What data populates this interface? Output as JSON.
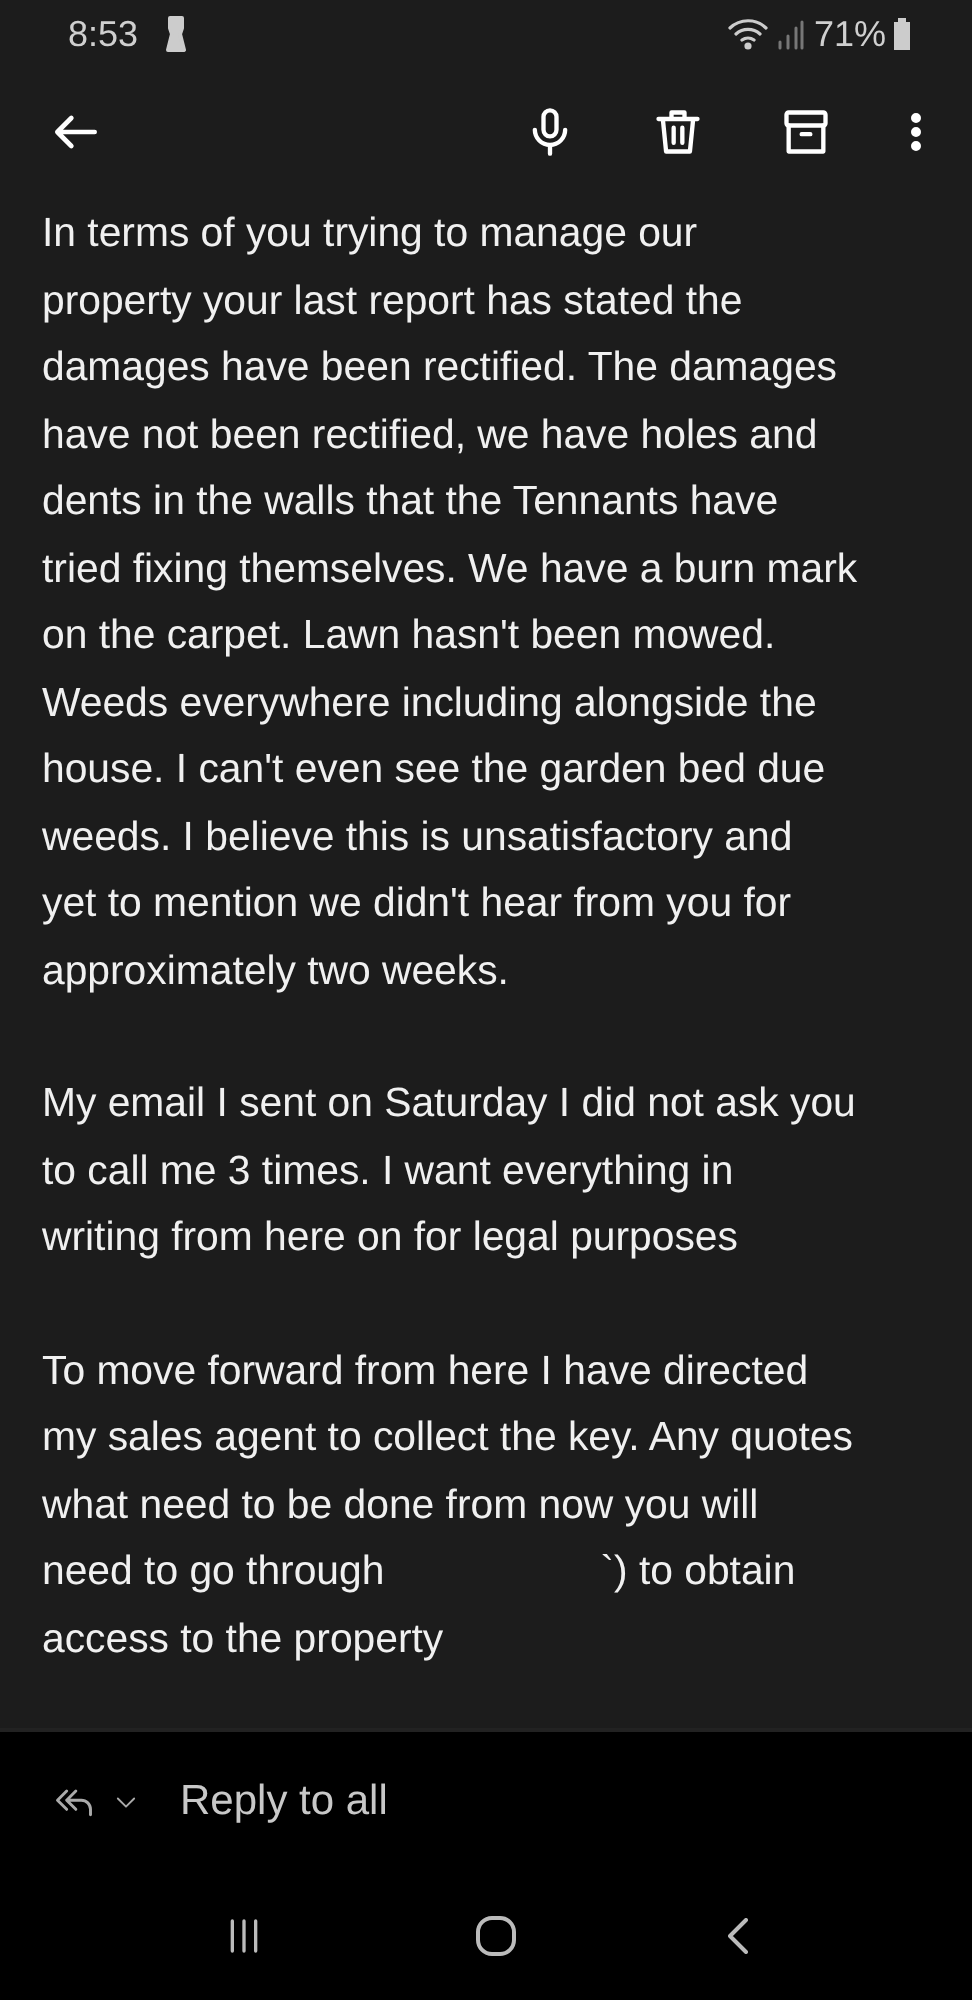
{
  "status_bar": {
    "time": "8:53",
    "battery": "71%"
  },
  "paragraphs": [
    {
      "segments": [
        "In terms of you trying to manage our\nproperty your last report has stated the\ndamages have been rectified. The damages\nhave not been rectified, we have holes and\ndents in the walls that the Tennants have\ntried fixing themselves. We have a burn mark\non the carpet. Lawn hasn't been mowed.\nWeeds everywhere including alongside the\nhouse. I can't even see the garden bed due\nweeds. I believe this is unsatisfactory and\nyet to mention we didn't hear from you for\napproximately two weeks."
      ]
    },
    {
      "segments": [
        "My email I sent on Saturday I did not ask you\nto call me 3 times. I want everything in\nwriting from here on for legal purposes"
      ]
    },
    {
      "segments": [
        "To move forward from here I have directed\nmy sales agent to collect the key. Any quotes\nwhat need to be done from now you will\nneed to go through",
        "`) to obtain\naccess to the property"
      ]
    }
  ],
  "reply": {
    "label": "Reply to all"
  }
}
